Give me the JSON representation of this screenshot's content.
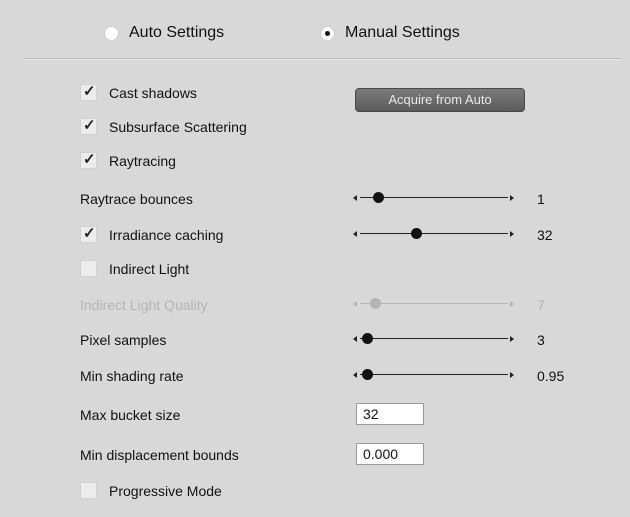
{
  "mode": {
    "auto_label": "Auto Settings",
    "manual_label": "Manual Settings",
    "selected": "manual"
  },
  "acquire_button": "Acquire from Auto",
  "options": {
    "cast_shadows": {
      "label": "Cast shadows",
      "checked": true
    },
    "subsurface": {
      "label": "Subsurface Scattering",
      "checked": true
    },
    "raytracing": {
      "label": "Raytracing",
      "checked": true
    },
    "irradiance": {
      "label": "Irradiance caching",
      "checked": true
    },
    "indirect_light": {
      "label": "Indirect Light",
      "checked": false
    },
    "progressive": {
      "label": "Progressive Mode",
      "checked": false
    }
  },
  "sliders": {
    "raytrace_bounces": {
      "label": "Raytrace bounces",
      "value": "1",
      "fraction": 0.12
    },
    "irradiance": {
      "value": "32",
      "fraction": 0.38
    },
    "indirect_quality": {
      "label": "Indirect Light Quality",
      "value": "7",
      "fraction": 0.1,
      "disabled": true
    },
    "pixel_samples": {
      "label": "Pixel samples",
      "value": "3",
      "fraction": 0.05
    },
    "min_shading_rate": {
      "label": "Min shading rate",
      "value": "0.95",
      "fraction": 0.05
    }
  },
  "fields": {
    "max_bucket": {
      "label": "Max bucket size",
      "value": "32"
    },
    "min_displacement": {
      "label": "Min displacement bounds",
      "value": "0.000"
    }
  }
}
